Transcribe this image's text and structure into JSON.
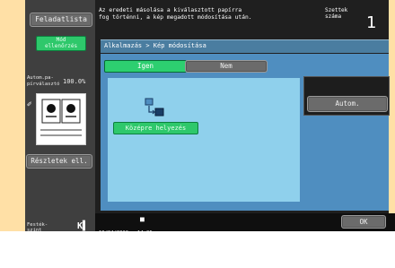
{
  "left_panel": {
    "job_list_label": "Feladatlista",
    "check_settings_label": "Mód\nellenőrzés",
    "original_label": "Autom.pa-\npírválasztó",
    "original_value": "100.0%",
    "details_label": "Részletek ell.",
    "copies_label": "Festék-\nszint"
  },
  "header": {
    "message": "Az eredeti másolása a kiválasztott papírra\nfog történni, a kép megadott módosítása után.",
    "copies_label": "Szettek\nszáma",
    "copies_value": "1"
  },
  "breadcrumb": "Alkalmazás > Kép módosítása",
  "toggle": {
    "yes_label": "Igen",
    "no_label": "Nem"
  },
  "center_button_label": "Középre helyezés",
  "auto_button_label": "Autom.",
  "footer": {
    "date_time": "19/04/2010   14:06",
    "memory": "Memória      100%"
  },
  "ok_label": "OK",
  "colors": {
    "accent_green": "#2ec86b",
    "content_blue": "#4f8ec0",
    "inner_panel": "#8fd0ec",
    "frame_orange": "#ffe0a6"
  }
}
